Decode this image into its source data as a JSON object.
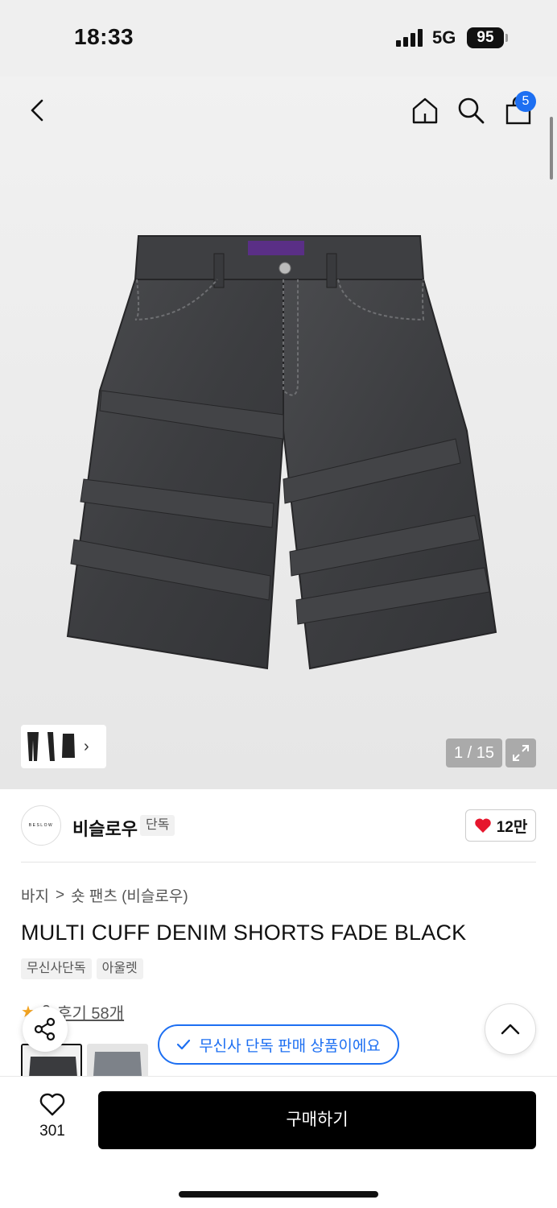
{
  "status_bar": {
    "time": "18:33",
    "network": "5G",
    "battery": "95"
  },
  "header": {
    "cart_count": "5"
  },
  "gallery": {
    "counter": "1 / 15"
  },
  "brand": {
    "logo_text": "BESLOW",
    "name": "비슬로우",
    "tag": "단독",
    "likes": "12만"
  },
  "breadcrumb": {
    "category": "바지",
    "separator": ">",
    "subcategory": "숏 팬츠 (비슬로우)"
  },
  "product": {
    "title": "MULTI CUFF DENIM SHORTS FADE BLACK",
    "tags": [
      "무신사단독",
      "아울렛"
    ],
    "rating_partial": "9",
    "review_link": "후기 58개"
  },
  "notice": {
    "exclusive": "무신사 단독 판매 상품이에요"
  },
  "bottom": {
    "wish_count": "301",
    "buy_label": "구매하기"
  },
  "colors": {
    "accent": "#1d6ff2",
    "like": "#e6162d",
    "buy_bg": "#000000"
  }
}
